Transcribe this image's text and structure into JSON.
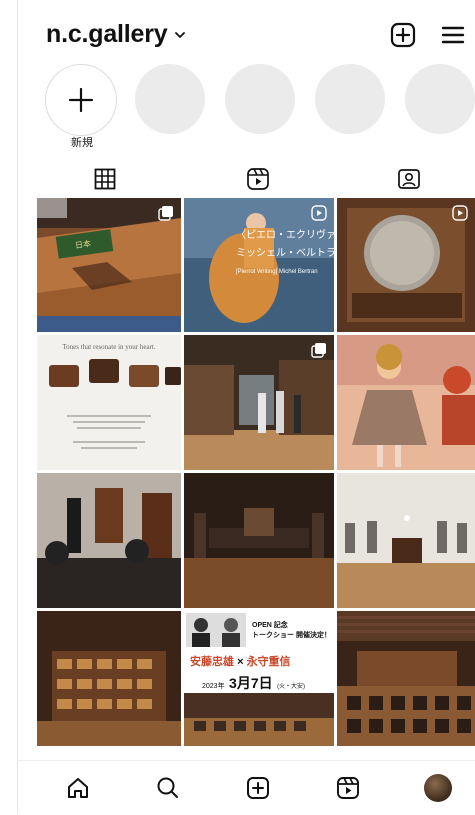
{
  "header": {
    "account_name": "n.c.gallery",
    "icons": [
      "chevron-down-icon",
      "add-square-icon",
      "menu-icon"
    ]
  },
  "stories": {
    "new_label": "新規",
    "items": [
      "add-icon",
      "placeholder",
      "placeholder",
      "placeholder",
      "placeholder"
    ]
  },
  "tabs": [
    {
      "name": "posts-grid",
      "icon": "grid-icon",
      "active": true
    },
    {
      "name": "reels",
      "icon": "reels-icon",
      "active": false
    },
    {
      "name": "tagged",
      "icon": "tagged-user-icon",
      "active": false
    }
  ],
  "posts": {
    "p2": {
      "title_line1": "〈ピエロ・エクリヴァン",
      "title_line2": "ミッシェル・ベルトラン",
      "subtitle": "[Pierrot Writing] Michel Bertran"
    },
    "p4": {
      "heading": "Tones that resonate in your heart."
    },
    "p11": {
      "line1": "OPEN 記念",
      "line2": "トークショー 開催決定！",
      "name_a": "安藤忠雄",
      "cross": "×",
      "name_b": "永守重信",
      "date_year": "2023年",
      "date_main": "3月7日",
      "date_day": "(火・大安)"
    }
  },
  "bottom_nav": [
    "home-icon",
    "search-icon",
    "create-icon",
    "reels-icon",
    "profile-avatar"
  ],
  "colors": {
    "story_placeholder": "#ebebeb",
    "accent_orange": "#c9492a"
  }
}
